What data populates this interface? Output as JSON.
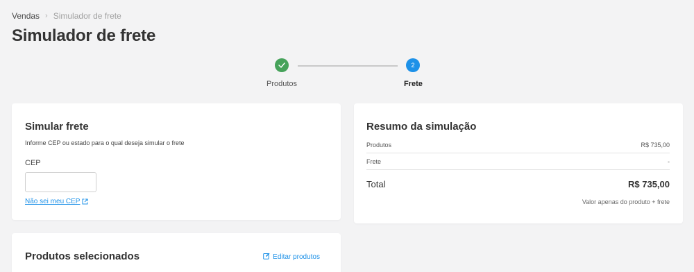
{
  "breadcrumb": {
    "root": "Vendas",
    "separator": "›",
    "current": "Simulador de frete"
  },
  "page": {
    "title": "Simulador de frete"
  },
  "stepper": {
    "steps": [
      {
        "label": "Produtos",
        "state": "done",
        "icon": "check-icon"
      },
      {
        "label": "Frete",
        "state": "active",
        "number": "2"
      }
    ]
  },
  "simular": {
    "title": "Simular frete",
    "description": "Informe CEP ou estado para o qual deseja simular o frete",
    "cep_label": "CEP",
    "cep_value": "",
    "cep_placeholder": "",
    "help_link": "Não sei meu CEP"
  },
  "resumo": {
    "title": "Resumo da simulação",
    "rows": [
      {
        "label": "Produtos",
        "value": "R$ 735,00"
      },
      {
        "label": "Frete",
        "value": "-"
      }
    ],
    "total_label": "Total",
    "total_value": "R$ 735,00",
    "note": "Valor apenas do produto + frete"
  },
  "selecionados": {
    "title": "Produtos selecionados",
    "edit_label": "Editar produtos"
  },
  "colors": {
    "accent": "#1d91e8",
    "success": "#46a25a",
    "background": "#f3f3f4"
  }
}
